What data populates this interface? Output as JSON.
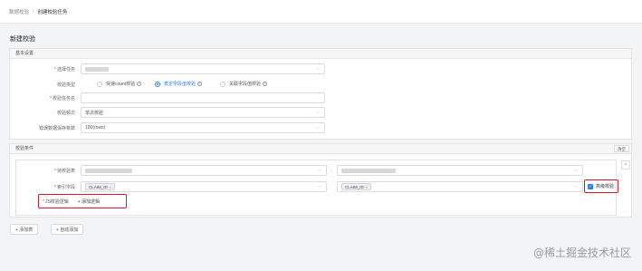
{
  "breadcrumb": {
    "parent": "数据校验",
    "separator": "/",
    "current": "创建校验任务"
  },
  "page_title": "新建校验",
  "basic": {
    "section_title": "基本设置",
    "task_label": "选择任务",
    "type_label": "校验类型",
    "type_options": [
      "快速count校验",
      "表定字段值校验",
      "关联字段值校验"
    ],
    "type_selected": 1,
    "name_label": "校验任务名",
    "freq_label": "校验频次",
    "freq_value": "单次校验",
    "retention_label": "错误数据保存条数",
    "retention_value": "100(rows)"
  },
  "conditions": {
    "section_title": "校验条件",
    "clear_label": "清空",
    "table_label": "待校验表",
    "arrow": "→",
    "index_label": "索引字段",
    "index_tag_left": "CLAIM_ID",
    "index_tag_right": "CLAIM_ID",
    "tag_close": "×",
    "advanced_label": "高级校验",
    "js_label": "JS校验逻辑",
    "add_logic_label": "+ 添加逻辑",
    "close_symbol": "×"
  },
  "actions": {
    "add_table": "+ 添加表",
    "auto_add": "+ 自动添加"
  },
  "watermark": "@稀土掘金技术社区",
  "colors": {
    "accent": "#2e7cf6",
    "highlight_box": "#d41b2c",
    "required": "#e23b3b"
  }
}
